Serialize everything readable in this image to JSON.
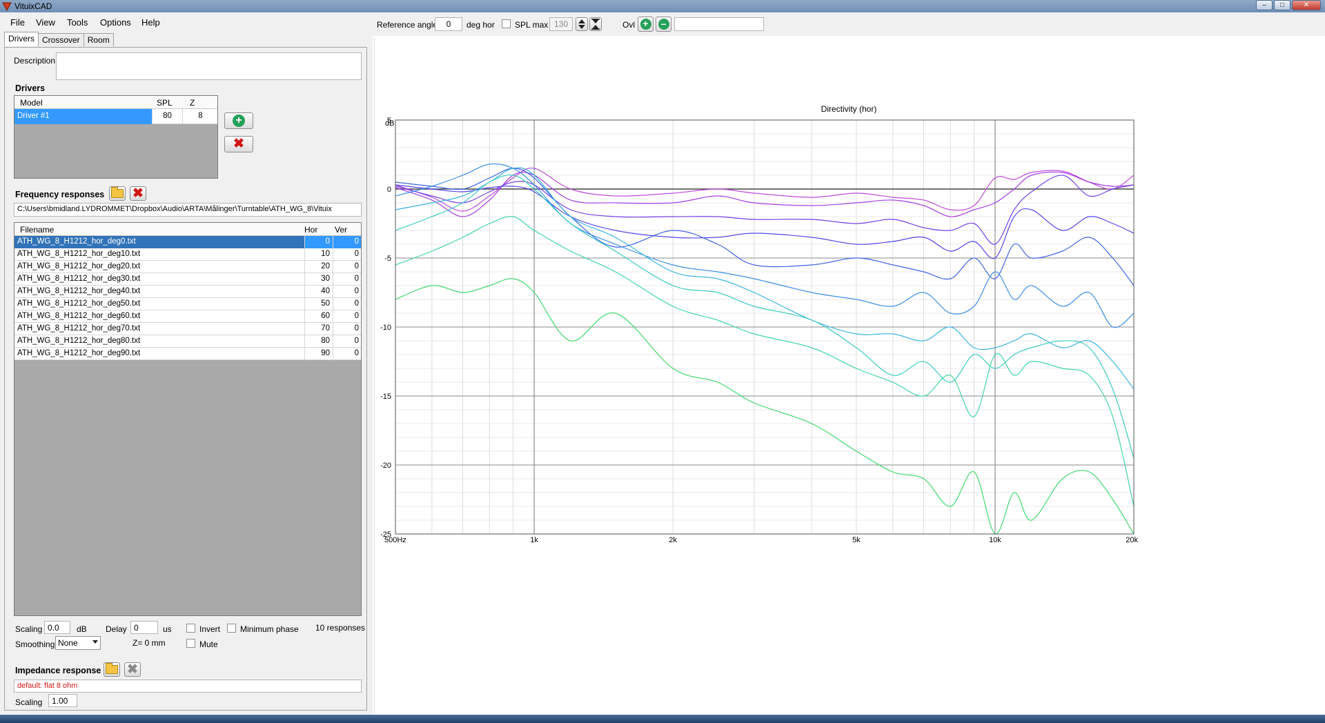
{
  "window": {
    "title": "VituixCAD"
  },
  "menu": [
    "File",
    "View",
    "Tools",
    "Options",
    "Help"
  ],
  "tabs": [
    "Drivers",
    "Crossover",
    "Room"
  ],
  "description": {
    "label": "Description",
    "value": ""
  },
  "drivers": {
    "heading": "Drivers",
    "columns": [
      "Model",
      "SPL",
      "Z"
    ],
    "rows": [
      {
        "model": "Driver #1",
        "spl": "80",
        "z": "8"
      }
    ]
  },
  "freq": {
    "heading": "Frequency responses",
    "path": "C:\\Users\\bmidland.LYDROMMET\\Dropbox\\Audio\\ARTA\\Målinger\\Turntable\\ATH_WG_8\\Vituix",
    "columns": [
      "Filename",
      "Hor",
      "Ver"
    ],
    "rows": [
      {
        "file": "ATH_WG_8_H1212_hor_deg0.txt",
        "hor": "0",
        "ver": "0"
      },
      {
        "file": "ATH_WG_8_H1212_hor_deg10.txt",
        "hor": "10",
        "ver": "0"
      },
      {
        "file": "ATH_WG_8_H1212_hor_deg20.txt",
        "hor": "20",
        "ver": "0"
      },
      {
        "file": "ATH_WG_8_H1212_hor_deg30.txt",
        "hor": "30",
        "ver": "0"
      },
      {
        "file": "ATH_WG_8_H1212_hor_deg40.txt",
        "hor": "40",
        "ver": "0"
      },
      {
        "file": "ATH_WG_8_H1212_hor_deg50.txt",
        "hor": "50",
        "ver": "0"
      },
      {
        "file": "ATH_WG_8_H1212_hor_deg60.txt",
        "hor": "60",
        "ver": "0"
      },
      {
        "file": "ATH_WG_8_H1212_hor_deg70.txt",
        "hor": "70",
        "ver": "0"
      },
      {
        "file": "ATH_WG_8_H1212_hor_deg80.txt",
        "hor": "80",
        "ver": "0"
      },
      {
        "file": "ATH_WG_8_H1212_hor_deg90.txt",
        "hor": "90",
        "ver": "0"
      }
    ],
    "scaling_label": "Scaling",
    "scaling_value": "0.0",
    "scaling_unit": "dB",
    "delay_label": "Delay",
    "delay_value": "0",
    "delay_unit": "us",
    "invert_label": "Invert",
    "minphase_label": "Minimum phase",
    "count": "10 responses",
    "smoothing_label": "Smoothing",
    "smoothing_value": "None",
    "z_label": "Z= 0 mm",
    "mute_label": "Mute"
  },
  "impedance": {
    "heading": "Impedance response",
    "value": "default: flat 8 ohm",
    "scaling_label": "Scaling",
    "scaling_value": "1.00"
  },
  "toolbar": {
    "ref_angle_label": "Reference angle",
    "ref_angle_value": "0",
    "deg_label": "deg hor",
    "splmax_label": "SPL max",
    "splmax_value": "130",
    "ovl_label": "Ovl",
    "ovl_value": ""
  },
  "chart_data": {
    "type": "line",
    "title": "Directivity (hor)",
    "ylabel": "dB",
    "xscale": "log",
    "xlim": [
      500,
      20000
    ],
    "ylim": [
      -25,
      5
    ],
    "grid": true,
    "x_tick_labels": [
      {
        "value": 500,
        "label": "500Hz"
      },
      {
        "value": 1000,
        "label": "1k"
      },
      {
        "value": 2000,
        "label": "2k"
      },
      {
        "value": 5000,
        "label": "5k"
      },
      {
        "value": 10000,
        "label": "10k"
      },
      {
        "value": 20000,
        "label": "20k"
      }
    ],
    "y_ticks": [
      5,
      0,
      -5,
      -10,
      -15,
      -20,
      -25
    ],
    "x": [
      500,
      600,
      700,
      800,
      900,
      1000,
      1200,
      1500,
      2000,
      2500,
      3000,
      4000,
      5000,
      6000,
      7000,
      8000,
      9000,
      10000,
      11000,
      12000,
      14000,
      16000,
      18000,
      20000
    ],
    "series": [
      {
        "color": "#c04ad8",
        "values": [
          0.3,
          -0.6,
          -1.6,
          -0.5,
          0.8,
          1.5,
          0.0,
          -0.5,
          -0.3,
          0.0,
          -0.3,
          -0.6,
          -0.3,
          -0.6,
          -0.8,
          -1.5,
          -1.2,
          0.8,
          0.7,
          1.2,
          1.3,
          0.5,
          0.0,
          1.0
        ]
      },
      {
        "color": "#a43ee0",
        "values": [
          0.1,
          -0.8,
          -2.0,
          -0.8,
          1.0,
          1.0,
          -0.8,
          -1.0,
          -1.0,
          -0.5,
          -1.0,
          -1.2,
          -1.0,
          -0.8,
          -1.2,
          -2.0,
          -1.5,
          -1.0,
          0.0,
          1.0,
          1.2,
          0.5,
          0.2,
          0.3
        ]
      },
      {
        "color": "#7240e6",
        "values": [
          0.2,
          -0.5,
          -1.0,
          -0.2,
          0.5,
          0.3,
          -1.5,
          -2.0,
          -2.0,
          -2.0,
          -2.2,
          -2.2,
          -2.5,
          -2.2,
          -2.8,
          -3.0,
          -2.5,
          -4.0,
          -1.5,
          -0.2,
          1.0,
          -0.5,
          0.0,
          0.3
        ]
      },
      {
        "color": "#5246e8",
        "values": [
          0.3,
          0.0,
          -0.2,
          0.1,
          0.2,
          -0.2,
          -2.0,
          -3.0,
          -3.5,
          -3.5,
          -3.2,
          -3.5,
          -4.0,
          -3.8,
          -3.5,
          -4.5,
          -3.8,
          -5.0,
          -2.0,
          -1.5,
          -3.0,
          -2.0,
          -2.5,
          -3.2
        ]
      },
      {
        "color": "#3f63e8",
        "values": [
          0.5,
          0.2,
          0.0,
          0.8,
          1.5,
          0.8,
          -2.0,
          -4.2,
          -3.0,
          -4.0,
          -5.5,
          -5.5,
          -5.0,
          -5.5,
          -6.0,
          -6.5,
          -5.0,
          -6.5,
          -4.0,
          -5.0,
          -4.5,
          -3.5,
          -5.0,
          -7.0
        ]
      },
      {
        "color": "#3b8ee6",
        "values": [
          -0.5,
          0.2,
          1.0,
          1.8,
          1.5,
          0.3,
          -2.5,
          -4.0,
          -5.5,
          -6.0,
          -6.5,
          -7.5,
          -8.0,
          -8.5,
          -7.5,
          -9.0,
          -8.5,
          -6.0,
          -8.0,
          -7.0,
          -8.5,
          -7.5,
          -10.0,
          -9.0
        ]
      },
      {
        "color": "#39b3e2",
        "values": [
          -1.5,
          -1.0,
          -0.5,
          0.5,
          1.5,
          1.0,
          -2.0,
          -3.5,
          -6.0,
          -6.5,
          -7.5,
          -9.5,
          -10.5,
          -10.5,
          -11.0,
          -10.0,
          -11.5,
          -11.5,
          -11.0,
          -10.5,
          -11.5,
          -11.0,
          -12.5,
          -14.5
        ]
      },
      {
        "color": "#3bcbc0",
        "values": [
          -3.0,
          -2.0,
          -1.0,
          0.5,
          1.0,
          0.0,
          -2.5,
          -4.5,
          -7.0,
          -7.5,
          -8.5,
          -9.5,
          -11.5,
          -13.5,
          -12.5,
          -14.0,
          -12.0,
          -13.0,
          -12.0,
          -11.5,
          -11.0,
          -11.5,
          -14.5,
          -19.5
        ]
      },
      {
        "color": "#3ed79a",
        "values": [
          -5.5,
          -4.5,
          -3.5,
          -2.5,
          -2.0,
          -3.0,
          -4.5,
          -6.0,
          -8.5,
          -9.5,
          -10.5,
          -11.5,
          -13.0,
          -14.0,
          -15.0,
          -13.5,
          -16.5,
          -12.0,
          -13.5,
          -12.5,
          -13.0,
          -13.5,
          -16.5,
          -23.0
        ]
      },
      {
        "color": "#3fd86a",
        "values": [
          -8.0,
          -7.0,
          -7.5,
          -7.0,
          -6.5,
          -7.5,
          -11.0,
          -9.0,
          -13.0,
          -14.0,
          -15.5,
          -17.0,
          -19.0,
          -20.5,
          -21.0,
          -23.0,
          -20.5,
          -25.0,
          -22.0,
          -24.0,
          -21.0,
          -20.5,
          -22.5,
          -25.0
        ]
      }
    ]
  }
}
